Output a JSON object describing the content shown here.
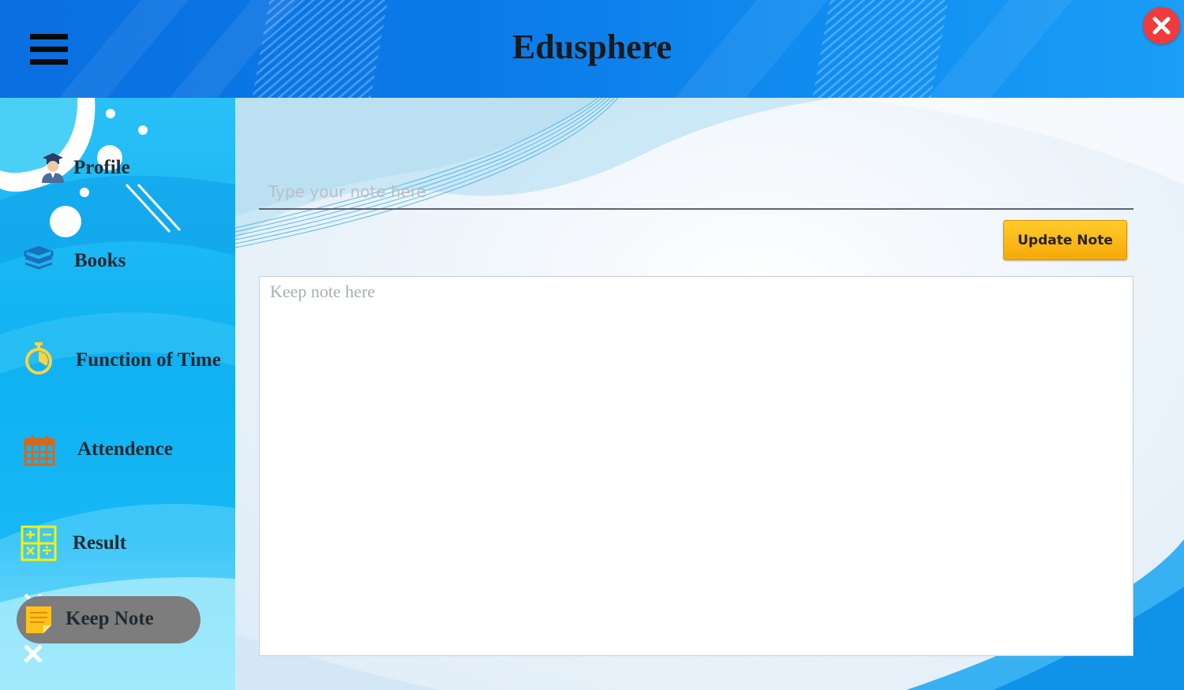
{
  "app": {
    "title": "Edusphere"
  },
  "sidebar": {
    "items": [
      {
        "label": "Profile",
        "icon": "graduate-icon"
      },
      {
        "label": "Books",
        "icon": "books-icon"
      },
      {
        "label": "Function of Time",
        "icon": "stopwatch-icon"
      },
      {
        "label": "Attendence",
        "icon": "calendar-icon"
      },
      {
        "label": "Result",
        "icon": "calculator-icon"
      },
      {
        "label": "Keep Note",
        "icon": "sticky-note-icon",
        "active": true
      }
    ]
  },
  "note_editor": {
    "title_placeholder": "Type your note here",
    "body_placeholder": "Keep note here",
    "update_label": "Update Note"
  },
  "colors": {
    "header": "#0b7ae8",
    "sidebar": "#16b8f4",
    "active_pill": "#7d7d7d",
    "update_button": "#f7b416",
    "close_button": "#ef3b3b"
  }
}
